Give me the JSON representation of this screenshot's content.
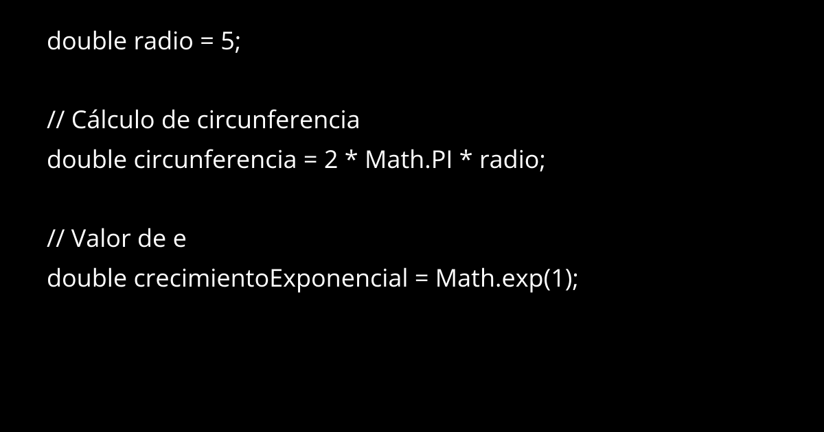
{
  "code": {
    "lines": [
      "double radio = 5;",
      "",
      "// Cálculo de circunferencia",
      "double circunferencia = 2 * Math.PI * radio;",
      "",
      "// Valor de e",
      "double crecimientoExponencial = Math.exp(1);"
    ]
  }
}
